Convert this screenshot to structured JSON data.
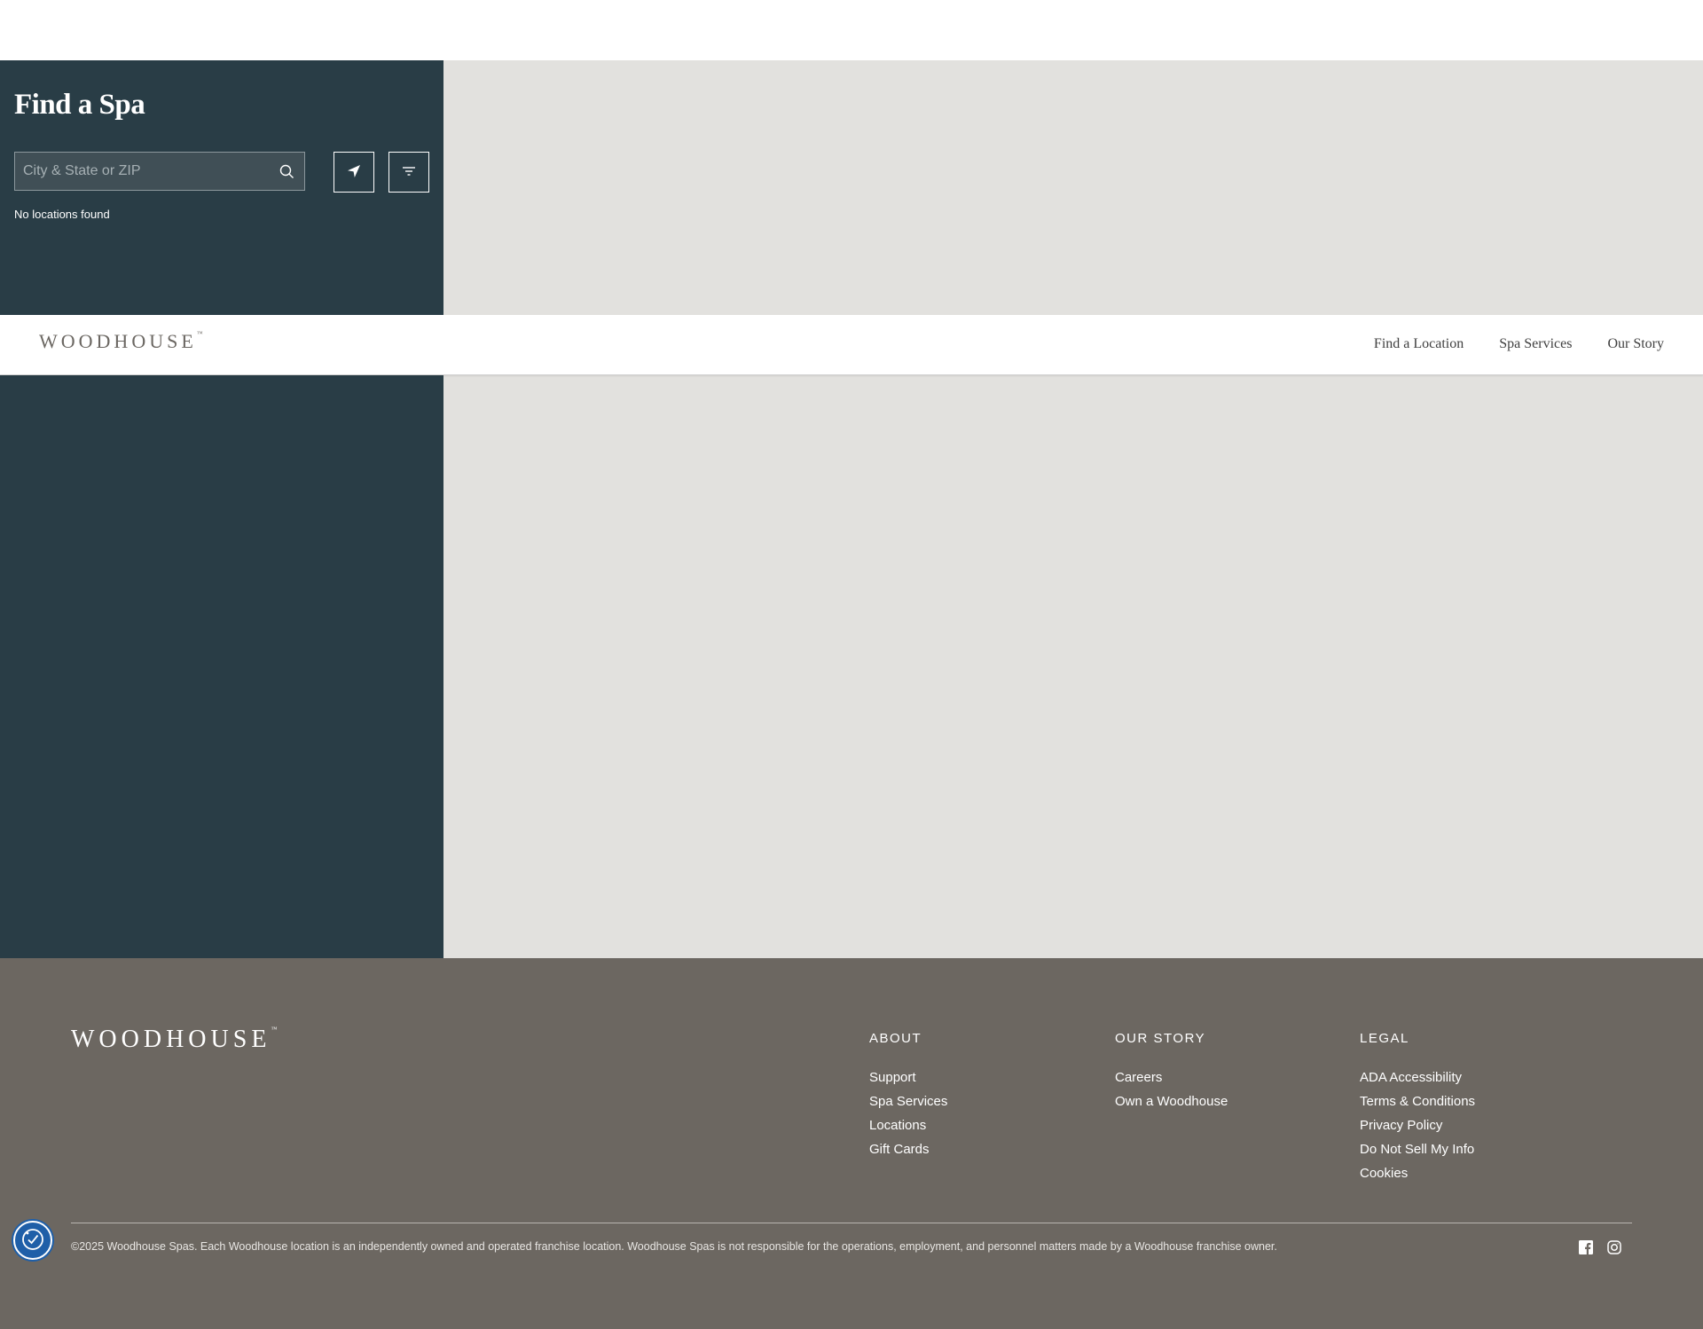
{
  "finder": {
    "title": "Find a Spa",
    "search_placeholder": "City & State or ZIP",
    "search_value": "",
    "no_results": "No locations found"
  },
  "nav": {
    "logo": "WOODHOUSE",
    "logo_mark": "™",
    "links": [
      "Find a Location",
      "Spa Services",
      "Our Story"
    ]
  },
  "footer": {
    "logo": "WOODHOUSE",
    "logo_mark": "™",
    "columns": [
      {
        "heading": "ABOUT",
        "links": [
          "Support",
          "Spa Services",
          "Locations",
          "Gift Cards"
        ]
      },
      {
        "heading": "OUR STORY",
        "links": [
          "Careers",
          "Own a Woodhouse"
        ]
      },
      {
        "heading": "LEGAL",
        "links": [
          "ADA Accessibility",
          "Terms & Conditions",
          "Privacy Policy",
          "Do Not Sell My Info",
          "Cookies"
        ]
      }
    ],
    "copyright": "©2025 Woodhouse Spas. Each Woodhouse location is an independently owned and operated franchise location. Woodhouse Spas is not responsible for the operations, employment, and personnel matters made by a Woodhouse franchise owner.",
    "social": [
      "facebook-icon",
      "instagram-icon"
    ]
  },
  "icons": {
    "search": "search-icon",
    "locate": "location-arrow-icon",
    "filter": "filter-icon",
    "accessibility": "accessibility-icon"
  },
  "colors": {
    "panel": "#293d46",
    "map": "#e2e1de",
    "footer": "#6c6761",
    "accessibility": "#1f5fa8"
  }
}
